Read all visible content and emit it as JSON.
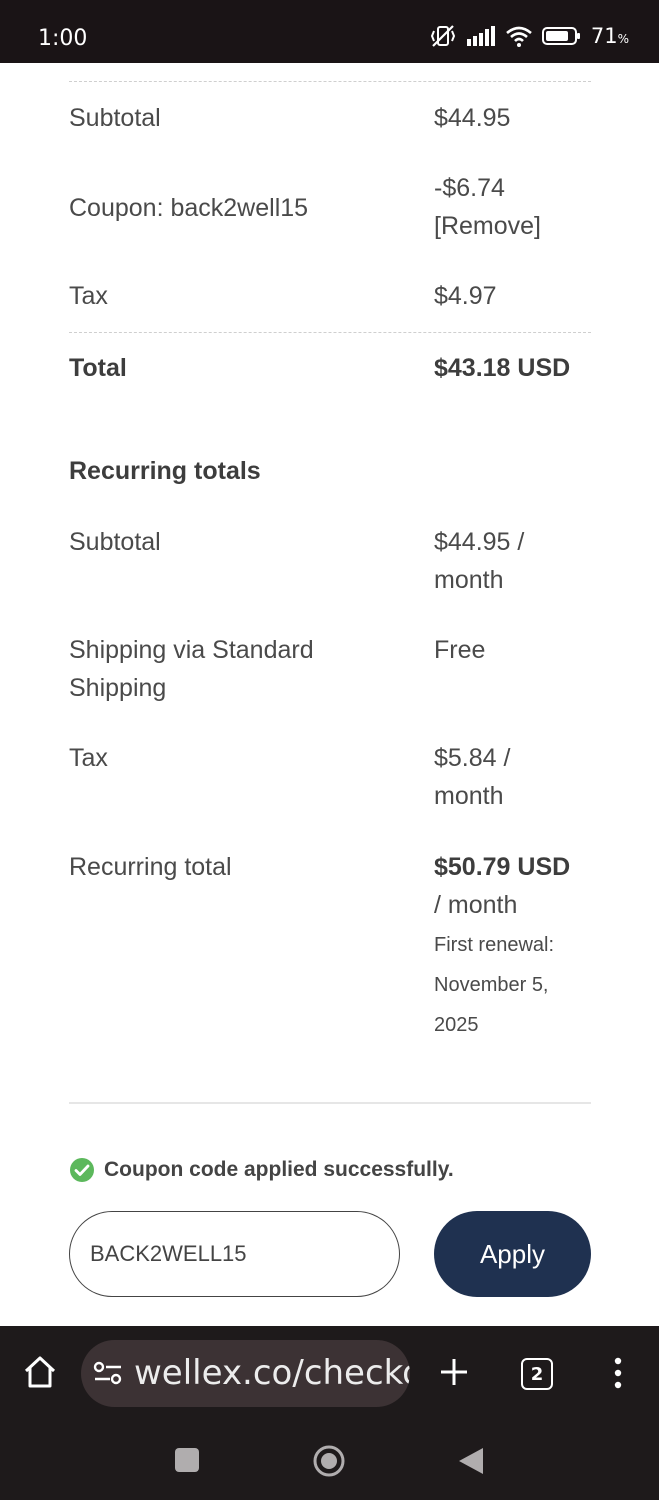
{
  "status_bar": {
    "time": "1:00",
    "battery_percent": "71",
    "battery_unit": "%",
    "icons": [
      "mute-vibrate-icon",
      "signal-icon",
      "wifi-icon",
      "battery-icon"
    ]
  },
  "order_summary": {
    "subtotal_label": "Subtotal",
    "subtotal_value": "$44.95",
    "coupon_label": "Coupon: back2well15",
    "coupon_discount": "-$6.74",
    "coupon_remove": "[Remove]",
    "tax_label": "Tax",
    "tax_value": "$4.97",
    "total_label": "Total",
    "total_value": "$43.18 USD"
  },
  "recurring": {
    "heading": "Recurring totals",
    "subtotal_label": "Subtotal",
    "subtotal_value_line1": "$44.95 /",
    "subtotal_value_line2": "month",
    "shipping_label_line1": "Shipping via Standard",
    "shipping_label_line2": "Shipping",
    "shipping_value": "Free",
    "tax_label": "Tax",
    "tax_value_line1": "$5.84 /",
    "tax_value_line2": "month",
    "total_label": "Recurring total",
    "total_value": "$50.79 USD",
    "total_period": "/ month",
    "renewal_line1": "First renewal:",
    "renewal_line2": "November 5,",
    "renewal_line3": "2025"
  },
  "coupon_form": {
    "success_message": "Coupon code applied successfully.",
    "input_value": "BACK2WELL15",
    "apply_label": "Apply"
  },
  "browser": {
    "url": "wellex.co/checkout",
    "tab_count": "2"
  },
  "colors": {
    "apply_button": "#1f3150",
    "success_check": "#5cb85c",
    "text": "#4a4a4a"
  }
}
